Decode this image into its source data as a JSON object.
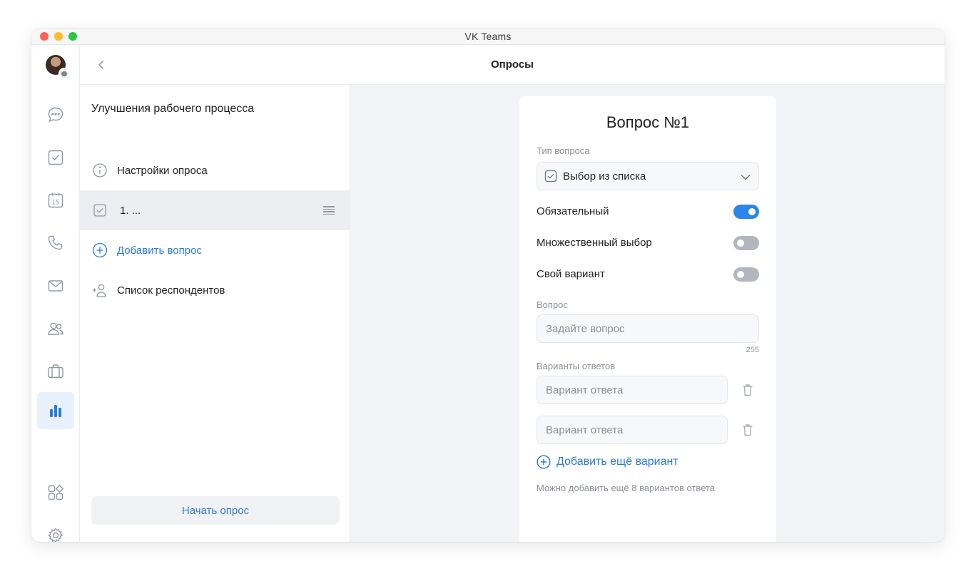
{
  "window": {
    "title": "VK Teams"
  },
  "rail": {
    "items": [
      {
        "icon": "chat-icon"
      },
      {
        "icon": "tasks-icon"
      },
      {
        "icon": "calendar-icon",
        "text": "15"
      },
      {
        "icon": "phone-icon"
      },
      {
        "icon": "mail-icon"
      },
      {
        "icon": "contacts-icon"
      },
      {
        "icon": "briefcase-icon"
      },
      {
        "icon": "polls-icon",
        "active": true
      },
      {
        "icon": "apps-icon"
      },
      {
        "icon": "settings-icon"
      }
    ]
  },
  "header": {
    "title": "Опросы"
  },
  "panel": {
    "title": "Улучшения рабочего процесса",
    "settings_label": "Настройки опроса",
    "question_item_label": "1. ...",
    "add_question_label": "Добавить вопрос",
    "respondents_label": "Список респондентов",
    "start_button": "Начать опрос"
  },
  "card": {
    "title": "Вопрос №1",
    "type_label": "Тип вопроса",
    "type_value": "Выбор из списка",
    "toggles": [
      {
        "label": "Обязательный",
        "on": true
      },
      {
        "label": "Множественный выбор",
        "on": false
      },
      {
        "label": "Свой вариант",
        "on": false
      }
    ],
    "question_label": "Вопрос",
    "question_placeholder": "Задайте вопрос",
    "question_counter": "255",
    "answers_label": "Варианты ответов",
    "answer_placeholder_1": "Вариант ответа",
    "answer_placeholder_2": "Вариант ответа",
    "add_variant_label": "Добавить ещё вариант",
    "hint": "Можно добавить ещё 8 вариантов ответа"
  },
  "colors": {
    "accent": "#2b7ad8",
    "switch_on": "#2b86e8",
    "content_bg": "#f2f3f5"
  }
}
